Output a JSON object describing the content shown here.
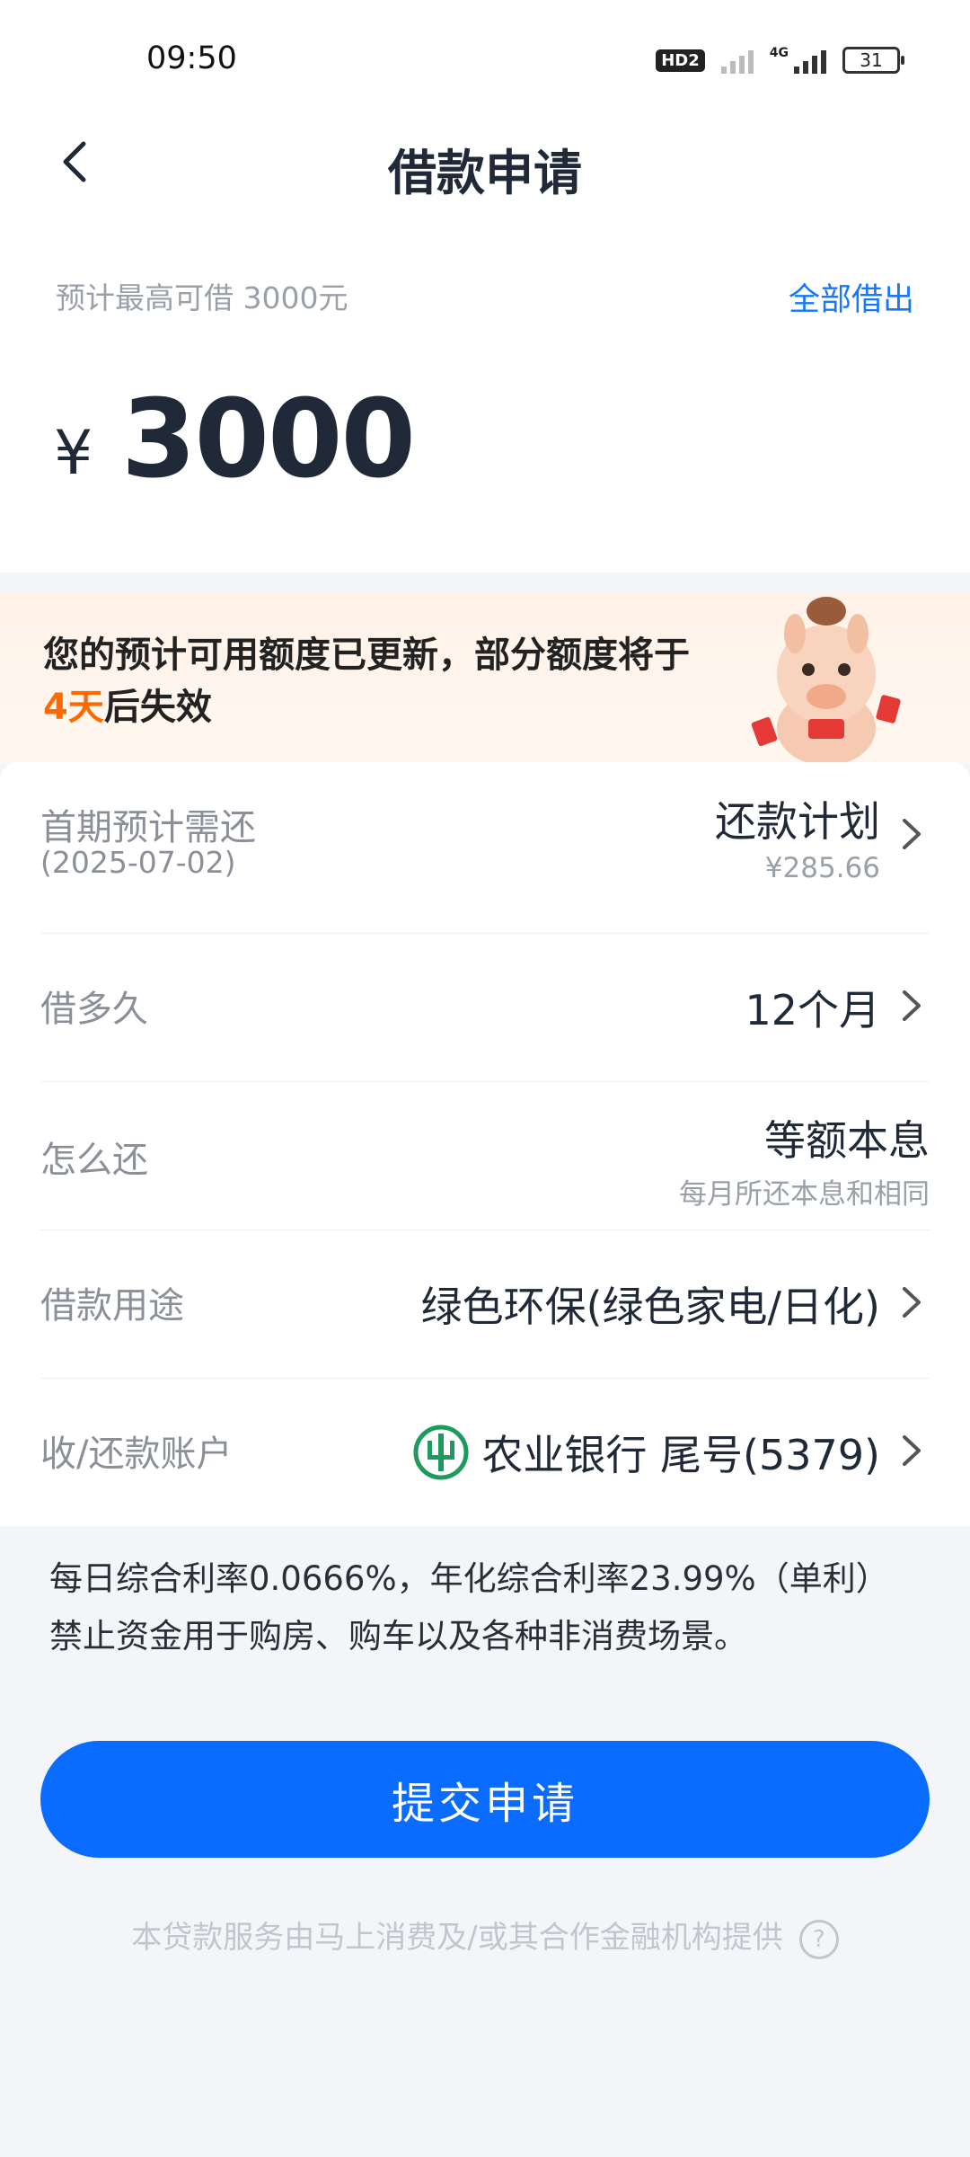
{
  "status_bar": {
    "time": "09:50",
    "hd_badge": "HD2",
    "network": "4G",
    "battery": "31"
  },
  "nav": {
    "title": "借款申请"
  },
  "limit": {
    "hint": "预计最高可借 3000元",
    "borrow_all_label": "全部借出",
    "currency_symbol": "¥",
    "amount": "3000"
  },
  "notice": {
    "text_before": "您的预计可用额度已更新，部分额度将于",
    "highlight": "4天",
    "text_after": "后失效"
  },
  "rows": {
    "first_payment": {
      "label": "首期预计需还",
      "date": "(2025-07-02)",
      "value": "还款计划",
      "amount": "¥285.66"
    },
    "term": {
      "label": "借多久",
      "value": "12个月"
    },
    "repay_method": {
      "label": "怎么还",
      "value": "等额本息",
      "desc": "每月所还本息和相同"
    },
    "purpose": {
      "label": "借款用途",
      "value": "绿色环保(绿色家电/日化)"
    },
    "account": {
      "label": "收/还款账户",
      "bank": "农业银行 尾号(5379)"
    }
  },
  "rate_note": {
    "line1": "每日综合利率0.0666%，年化综合利率23.99%（单利）",
    "line2": "禁止资金用于购房、购车以及各种非消费场景。"
  },
  "submit": {
    "label": "提交申请"
  },
  "footer": {
    "text": "本贷款服务由马上消费及/或其合作金融机构提供",
    "help": "?"
  },
  "colors": {
    "accent": "#0a6cff",
    "link": "#1677ff",
    "highlight": "#ff6a00",
    "bank_green": "#1e9a5f"
  }
}
